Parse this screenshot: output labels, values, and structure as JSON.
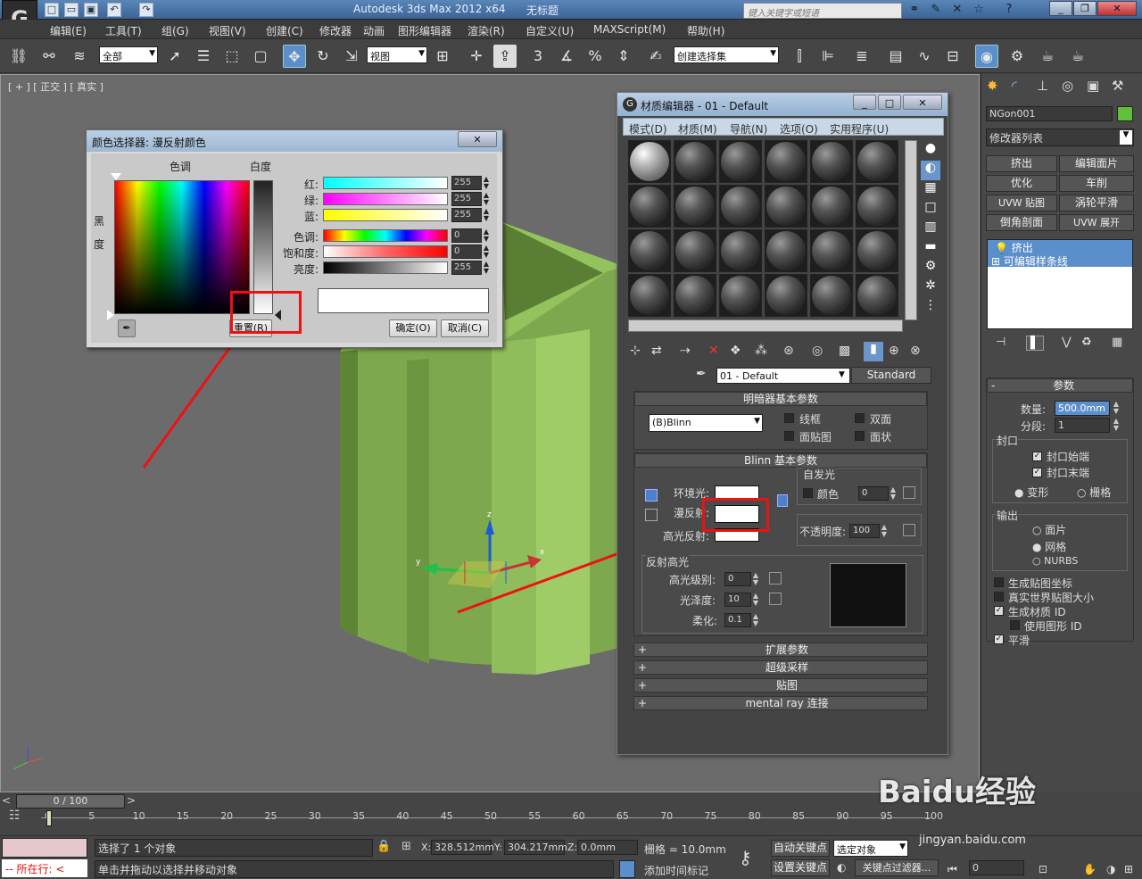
{
  "titlebar": {
    "app": "Autodesk 3ds Max  2012 x64",
    "file": "无标题",
    "search_placeholder": "键入关键字或短语"
  },
  "menu": [
    "编辑(E)",
    "工具(T)",
    "组(G)",
    "视图(V)",
    "创建(C)",
    "修改器",
    "动画",
    "图形编辑器",
    "渲染(R)",
    "自定义(U)",
    "MAXScript(M)",
    "帮助(H)"
  ],
  "toolbar": {
    "filter": "全部",
    "coord": "视图",
    "selection_set": "创建选择集",
    "snap3": "3"
  },
  "viewport": {
    "label": "[ + ] [ 正交 ] [ 真实 ]",
    "axis_x": "x",
    "axis_y": "y",
    "axis_z": "z"
  },
  "colorpicker": {
    "title": "颜色选择器: 漫反射颜色",
    "hue_label": "色调",
    "white_label": "白度",
    "black_label_1": "黑",
    "black_label_2": "度",
    "rows": [
      {
        "label": "红:",
        "value": "255"
      },
      {
        "label": "绿:",
        "value": "255"
      },
      {
        "label": "蓝:",
        "value": "255"
      },
      {
        "label": "色调:",
        "value": "0"
      },
      {
        "label": "饱和度:",
        "value": "0"
      },
      {
        "label": "亮度:",
        "value": "255"
      }
    ],
    "reset": "重置(R)",
    "ok": "确定(O)",
    "cancel": "取消(C)"
  },
  "mateditor": {
    "title": "材质编辑器 - 01 - Default",
    "menu": [
      "模式(D)",
      "材质(M)",
      "导航(N)",
      "选项(O)",
      "实用程序(U)"
    ],
    "mat_name": "01 - Default",
    "mat_type": "Standard",
    "shader_rollout": "明暗器基本参数",
    "shader": "(B)Blinn",
    "wire": "线框",
    "twosided": "双面",
    "facemap": "面贴图",
    "faceted": "面状",
    "blinn_rollout": "Blinn 基本参数",
    "selfillum": "自发光",
    "color": "颜色",
    "selfillum_val": "0",
    "ambient": "环境光:",
    "diffuse": "漫反射:",
    "specular": "高光反射:",
    "opacity": "不透明度:",
    "opacity_val": "100",
    "spec_highlights": "反射高光",
    "spec_level": "高光级别:",
    "spec_level_val": "0",
    "gloss": "光泽度:",
    "gloss_val": "10",
    "soften": "柔化:",
    "soften_val": "0.1",
    "rollouts": [
      "扩展参数",
      "超级采样",
      "贴图",
      "mental ray 连接"
    ]
  },
  "cmdpanel": {
    "obj_name": "NGon001",
    "modlist": "修改器列表",
    "mods": [
      "挤出",
      "编辑面片",
      "优化",
      "车削",
      "UVW 贴图",
      "涡轮平滑",
      "倒角剖面",
      "UVW 展开"
    ],
    "stack": [
      "挤出",
      "可编辑样条线"
    ],
    "params": "参数",
    "amount_lbl": "数量:",
    "amount": "500.0mm",
    "segs_lbl": "分段:",
    "segs": "1",
    "cap": "封口",
    "cap_start": "封口始端",
    "cap_end": "封口末端",
    "morph": "变形",
    "grid": "栅格",
    "output": "输出",
    "patch": "面片",
    "mesh": "网格",
    "nurbs": "NURBS",
    "gen_map": "生成贴图坐标",
    "real_world": "真实世界贴图大小",
    "gen_matid": "生成材质 ID",
    "use_shape": "使用图形 ID",
    "smooth": "平滑"
  },
  "timeline": {
    "frame": "0 / 100",
    "ticks": [
      "0",
      "5",
      "10",
      "15",
      "20",
      "25",
      "30",
      "35",
      "40",
      "45",
      "50",
      "55",
      "60",
      "65",
      "70",
      "75",
      "80",
      "85",
      "90",
      "95",
      "100"
    ]
  },
  "status": {
    "selected": "选择了 1 个对象",
    "hint": "单击并拖动以选择并移动对象",
    "running": "所在行:",
    "x_lbl": "X:",
    "x": "328.512mm",
    "y_lbl": "Y:",
    "y": "304.217mm",
    "z_lbl": "Z:",
    "z": "0.0mm",
    "grid": "栅格 = 10.0mm",
    "autokey": "自动关键点",
    "setkey": "设置关键点",
    "sel_obj": "选定对象",
    "key_filter": "关键点过滤器...",
    "add_time": "添加时间标记",
    "frame_val": "0"
  },
  "watermark": "Baidu经验",
  "watermark_url": "jingyan.baidu.com"
}
